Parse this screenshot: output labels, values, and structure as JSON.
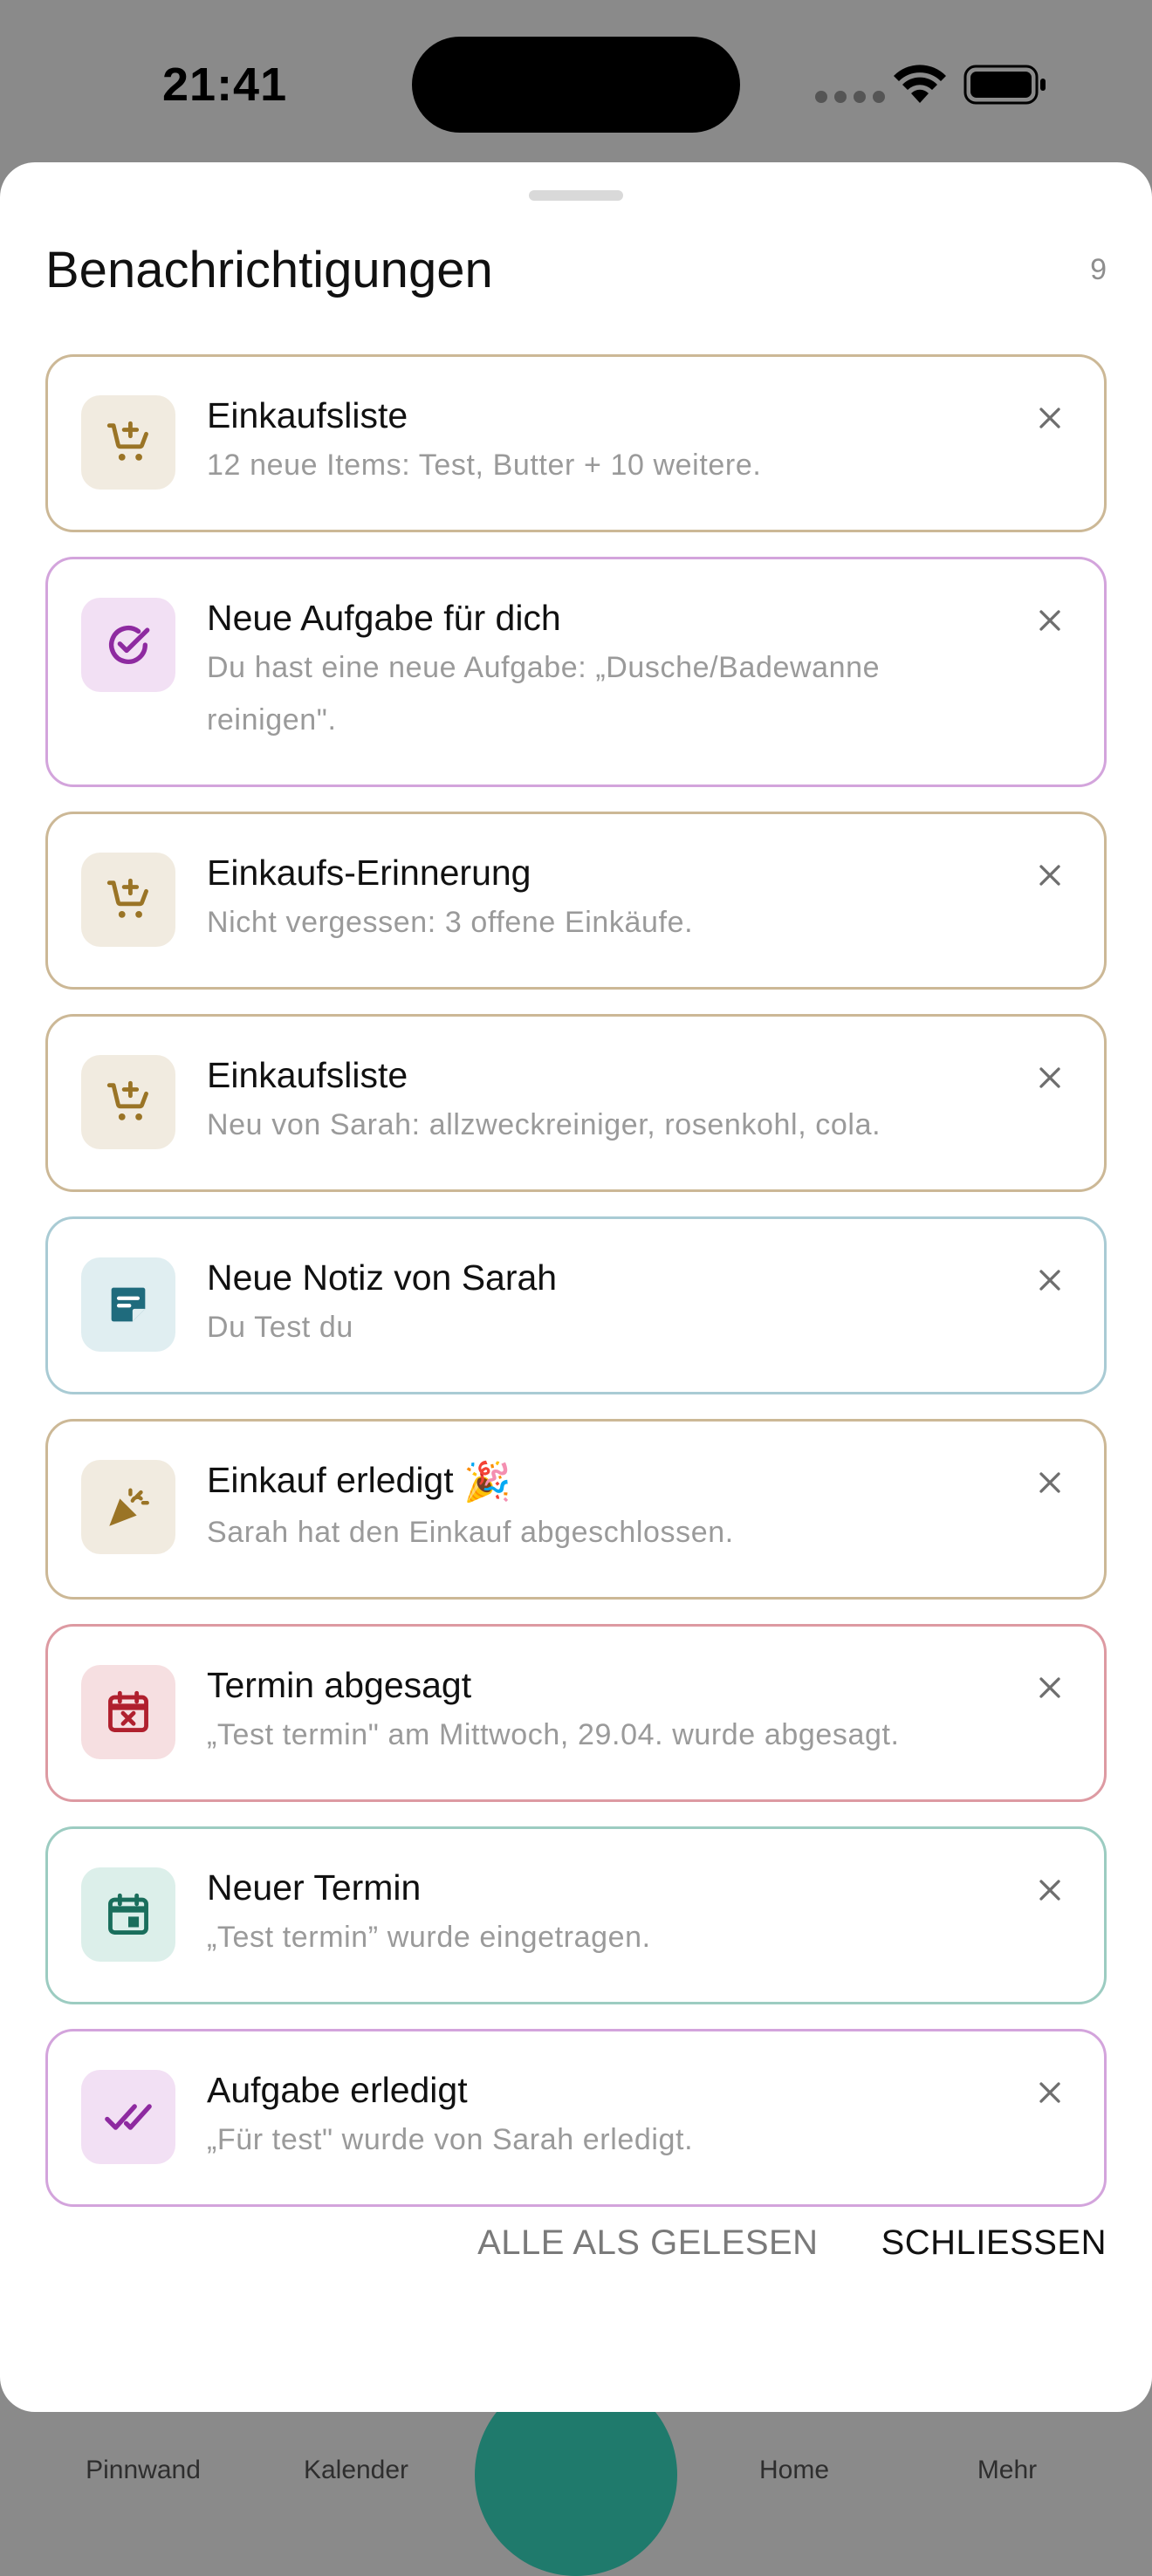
{
  "status_bar": {
    "time": "21:41"
  },
  "background_nav": {
    "items": [
      {
        "label": "Pinnwand"
      },
      {
        "label": "Kalender"
      },
      {
        "label": "Home"
      },
      {
        "label": "Mehr"
      }
    ]
  },
  "sheet": {
    "title": "Benachrichtigungen",
    "count": "9",
    "notifications": [
      {
        "icon": "cart-plus-icon",
        "accent": "#ccb896",
        "tile": "#f1ebe0",
        "iconColor": "#9a7426",
        "title": "Einkaufsliste",
        "body": "12 neue Items: Test, Butter + 10 weitere."
      },
      {
        "icon": "check-circle-icon",
        "accent": "#d3a4dc",
        "tile": "#f2e0f4",
        "iconColor": "#8e2aa0",
        "title": "Neue Aufgabe für dich",
        "body": "Du hast eine neue Aufgabe: „Dusche/Badewanne reinigen\"."
      },
      {
        "icon": "cart-plus-icon",
        "accent": "#ccb896",
        "tile": "#f1ebe0",
        "iconColor": "#9a7426",
        "title": "Einkaufs-Erinnerung",
        "body": "Nicht vergessen: 3 offene Einkäufe."
      },
      {
        "icon": "cart-plus-icon",
        "accent": "#ccb896",
        "tile": "#f1ebe0",
        "iconColor": "#9a7426",
        "title": "Einkaufsliste",
        "body": "Neu von Sarah: allzweckreiniger, rosenkohl, cola."
      },
      {
        "icon": "sticky-note-icon",
        "accent": "#a9cbd4",
        "tile": "#e0eef1",
        "iconColor": "#1f6b7d",
        "title": "Neue Notiz von Sarah",
        "body": "Du Test du"
      },
      {
        "icon": "party-popper-icon",
        "accent": "#ccb896",
        "tile": "#f1ebe0",
        "iconColor": "#9a7426",
        "title": "Einkauf erledigt",
        "title_emoji": "🎉",
        "body": "Sarah hat den Einkauf abgeschlossen."
      },
      {
        "icon": "calendar-x-icon",
        "accent": "#dd9aa2",
        "tile": "#f6dfe1",
        "iconColor": "#b0202e",
        "title": "Termin abgesagt",
        "body": "„Test termin\" am Mittwoch, 29.04. wurde abgesagt."
      },
      {
        "icon": "calendar-event-icon",
        "accent": "#9cccc1",
        "tile": "#dcefea",
        "iconColor": "#1a6e5c",
        "title": "Neuer Termin",
        "body": "„Test termin” wurde eingetragen."
      },
      {
        "icon": "double-check-icon",
        "accent": "#d3a4dc",
        "tile": "#f2e0f4",
        "iconColor": "#8e2aa0",
        "title": "Aufgabe erledigt",
        "body": "„Für test\" wurde von Sarah erledigt."
      }
    ],
    "actions": {
      "mark_all_read": "ALLE ALS GELESEN",
      "close": "SCHLIESSEN"
    }
  }
}
